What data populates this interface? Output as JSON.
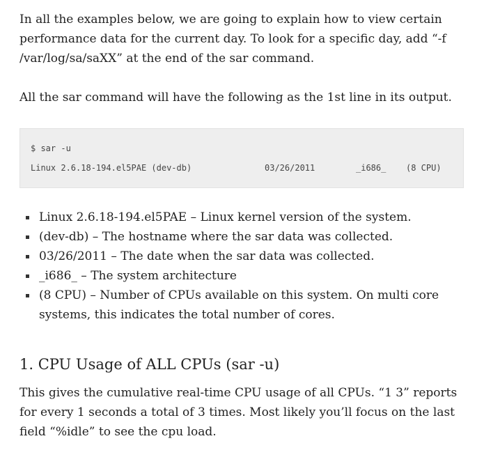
{
  "intro": "In all the examples below, we are going to explain how to view certain performance data for the current day. To look for a specific day, add “-f /var/log/sa/saXX” at the end of the sar command.",
  "first_line_note": "All the sar command will have the following as the 1st line in its output.",
  "code": {
    "command": "$ sar -u",
    "kernel": "Linux 2.6.18-194.el5PAE (dev-db)",
    "date": "03/26/2011",
    "arch": "_i686_",
    "cpu": "(8 CPU)"
  },
  "bullets": [
    "Linux 2.6.18-194.el5PAE – Linux kernel version of the system.",
    "(dev-db) – The hostname where the sar data was collected.",
    "03/26/2011 – The date when the sar data was collected.",
    "_i686_ – The system architecture",
    "(8 CPU) – Number of CPUs available on this system. On multi core systems, this indicates the total number of cores."
  ],
  "section_heading": "1. CPU Usage of ALL CPUs (sar -u)",
  "section_text": "This gives the cumulative real-time CPU usage of all CPUs. “1 3” reports for every 1 seconds a total of 3 times. Most likely you’ll focus on the last field “%idle” to see the cpu load."
}
